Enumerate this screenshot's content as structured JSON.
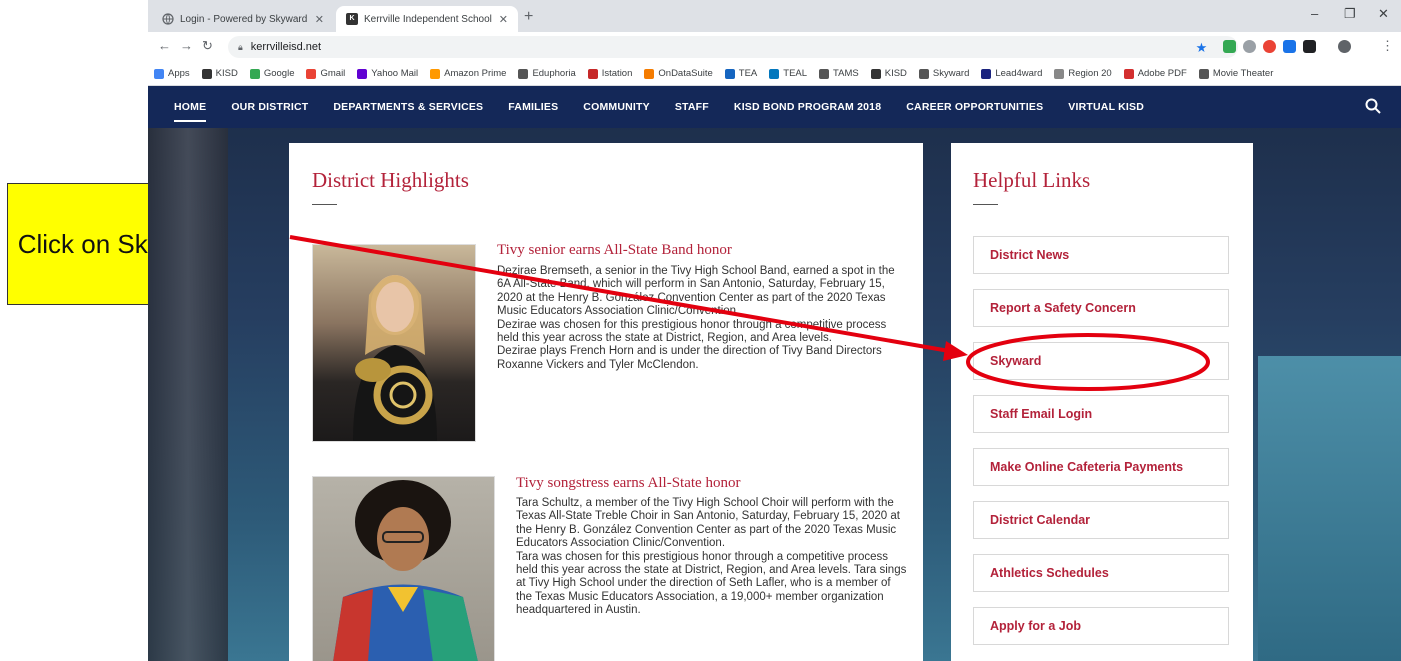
{
  "browser": {
    "tabs": [
      {
        "title": "Login - Powered by Skyward"
      },
      {
        "title": "Kerrville Independent School Di..."
      }
    ],
    "new_tab_symbol": "+",
    "window_controls": [
      "–",
      "❐",
      "✕"
    ],
    "url": "kerrvilleisd.net",
    "bookmarks": [
      {
        "label": "Apps",
        "color": "#4285f4"
      },
      {
        "label": "KISD",
        "color": "#333333"
      },
      {
        "label": "Google",
        "color": "#34a853"
      },
      {
        "label": "Gmail",
        "color": "#ea4335"
      },
      {
        "label": "Yahoo Mail",
        "color": "#6001d2"
      },
      {
        "label": "Amazon Prime",
        "color": "#ff9900"
      },
      {
        "label": "Eduphoria",
        "color": "#555555"
      },
      {
        "label": "Istation",
        "color": "#c62828"
      },
      {
        "label": "OnDataSuite",
        "color": "#f57c00"
      },
      {
        "label": "TEA",
        "color": "#1565c0"
      },
      {
        "label": "TEAL",
        "color": "#0277bd"
      },
      {
        "label": "TAMS",
        "color": "#555555"
      },
      {
        "label": "KISD",
        "color": "#333333"
      },
      {
        "label": "Skyward",
        "color": "#555555"
      },
      {
        "label": "Lead4ward",
        "color": "#1a237e"
      },
      {
        "label": "Region 20",
        "color": "#888888"
      },
      {
        "label": "Adobe PDF",
        "color": "#d32f2f"
      },
      {
        "label": "Movie Theater",
        "color": "#555555"
      }
    ]
  },
  "nav": {
    "items": [
      "HOME",
      "OUR DISTRICT",
      "DEPARTMENTS & SERVICES",
      "FAMILIES",
      "COMMUNITY",
      "STAFF",
      "KISD BOND PROGRAM 2018",
      "CAREER OPPORTUNITIES",
      "VIRTUAL KISD"
    ]
  },
  "highlights": {
    "title": "District Highlights",
    "articles": [
      {
        "headline": "Tivy senior earns All-State Band honor",
        "body": "Dezirae Bremseth, a senior in the Tivy High School Band, earned a spot in the 6A All-State Band, which will perform in San Antonio, Saturday, February 15, 2020 at the Henry B. González Convention Center as part of the 2020 Texas Music Educators Association Clinic/Convention.\nDezirae was chosen for this prestigious honor through a competitive process held this year across the state at District, Region, and Area levels.\nDezirae plays French Horn and is under the direction of Tivy Band Directors Roxanne Vickers and Tyler McClendon."
      },
      {
        "headline": "Tivy songstress earns All-State honor",
        "body": "Tara Schultz, a member of the Tivy High School Choir will perform with the Texas All-State Treble Choir in San Antonio, Saturday, February 15, 2020 at the Henry B. González Convention Center as part of the 2020 Texas Music Educators Association Clinic/Convention.\nTara was chosen for this prestigious honor through a competitive process held this year across the state at District, Region, and Area levels. Tara sings at Tivy High School under the direction of Seth Lafler, who is a member of the Texas Music Educators Association, a 19,000+ member organization headquartered in Austin."
      }
    ]
  },
  "helpful_links": {
    "title": "Helpful Links",
    "items": [
      "District News",
      "Report a Safety Concern",
      "Skyward",
      "Staff Email Login",
      "Make Online Cafeteria Payments",
      "District Calendar",
      "Athletics Schedules",
      "Apply for a Job"
    ]
  },
  "annotation": {
    "callout_text": "Click on Skyward Link.",
    "accent_color": "#e3000f"
  },
  "colors": {
    "nav_bg": "#142858",
    "heading_red": "#b3223a"
  }
}
